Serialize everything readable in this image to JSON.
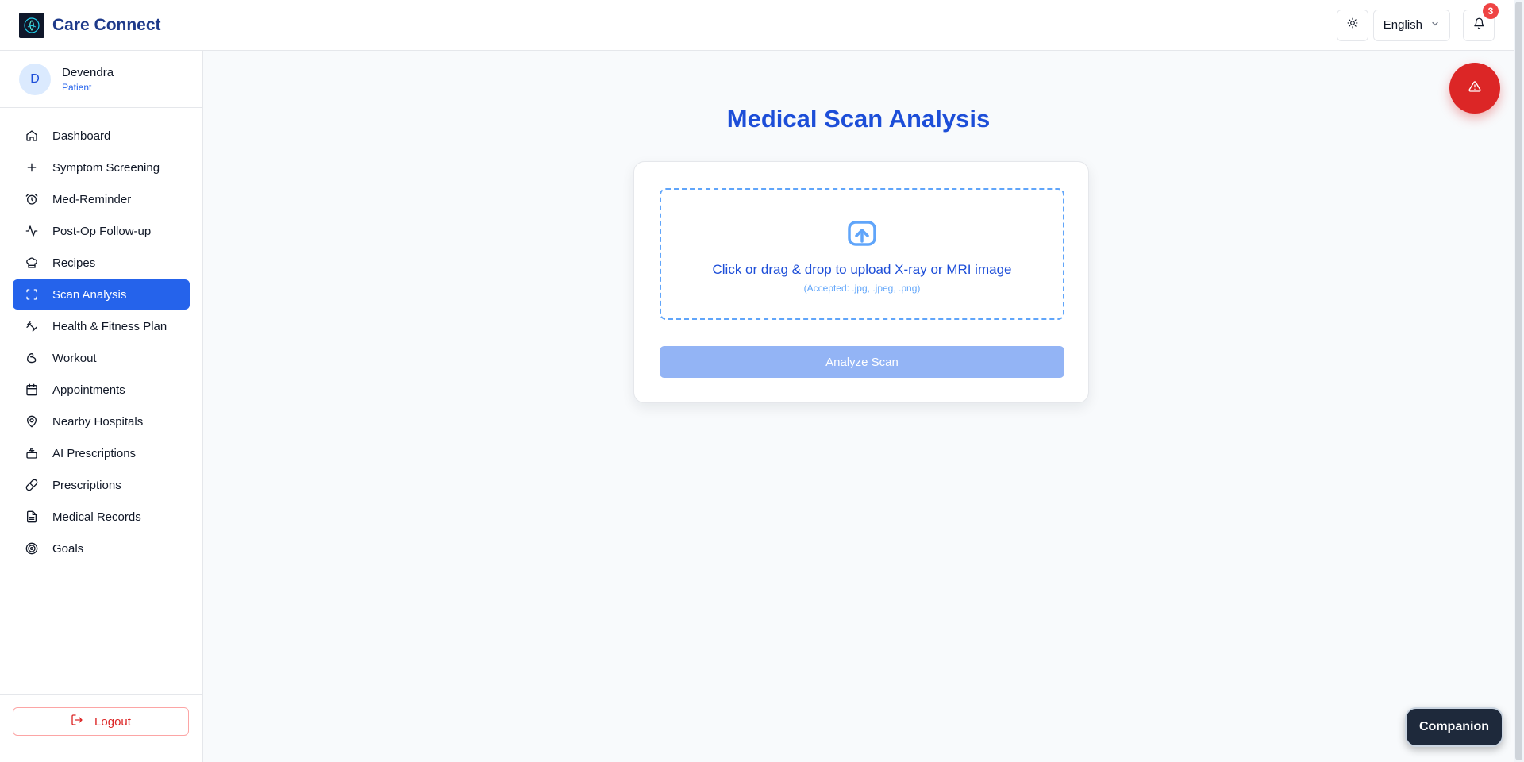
{
  "app": {
    "title": "Care Connect"
  },
  "header": {
    "language": "English",
    "notification_count": "3"
  },
  "user": {
    "initial": "D",
    "name": "Devendra",
    "role": "Patient"
  },
  "sidebar": {
    "items": [
      {
        "label": "Dashboard",
        "icon": "home-icon"
      },
      {
        "label": "Symptom Screening",
        "icon": "plus-icon"
      },
      {
        "label": "Med-Reminder",
        "icon": "alarm-clock-icon"
      },
      {
        "label": "Post-Op Follow-up",
        "icon": "activity-icon"
      },
      {
        "label": "Recipes",
        "icon": "chef-hat-icon"
      },
      {
        "label": "Scan Analysis",
        "icon": "scan-icon",
        "active": true
      },
      {
        "label": "Health & Fitness Plan",
        "icon": "fitness-icon"
      },
      {
        "label": "Workout",
        "icon": "biceps-icon"
      },
      {
        "label": "Appointments",
        "icon": "calendar-icon"
      },
      {
        "label": "Nearby Hospitals",
        "icon": "map-pin-icon"
      },
      {
        "label": "AI Prescriptions",
        "icon": "bot-icon"
      },
      {
        "label": "Prescriptions",
        "icon": "pill-icon"
      },
      {
        "label": "Medical Records",
        "icon": "file-text-icon"
      },
      {
        "label": "Goals",
        "icon": "target-icon"
      }
    ],
    "logout_label": "Logout"
  },
  "main": {
    "title": "Medical Scan Analysis",
    "upload_text": "Click or drag & drop to upload X-ray or MRI image",
    "upload_hint": "(Accepted: .jpg, .jpeg, .png)",
    "analyze_label": "Analyze Scan"
  },
  "floating": {
    "companion_label": "Companion"
  },
  "colors": {
    "accent": "#2563eb",
    "danger": "#dc2626",
    "brand_text": "#1e3a8a"
  }
}
